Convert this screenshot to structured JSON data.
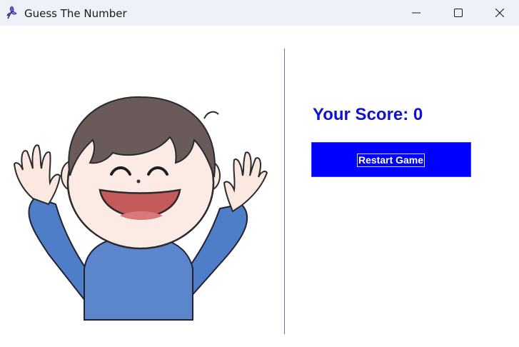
{
  "window": {
    "title": "Guess The Number",
    "icon": "feather-quill-icon",
    "controls": [
      "minimize-icon",
      "maximize-icon",
      "close-icon"
    ]
  },
  "main": {
    "score_text": "Your Score: 0",
    "restart_label": "Restart Game",
    "illustration": "happy-cheering-child"
  },
  "colors": {
    "accent": "#0000ff",
    "score_text": "#1010d6",
    "titlebar": "#eef1f8",
    "divider": "#5f7e86"
  }
}
